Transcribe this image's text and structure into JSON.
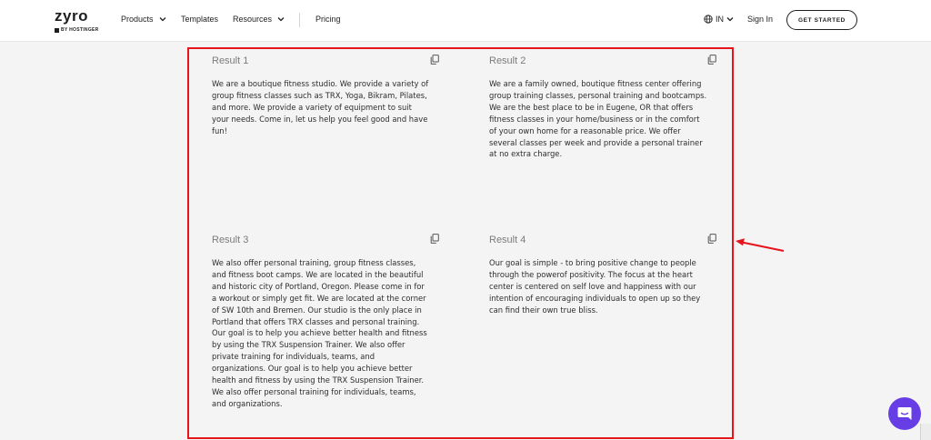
{
  "header": {
    "logo_word": "zyro",
    "logo_sub": "BY HOSTINGER",
    "nav": {
      "products": "Products",
      "templates": "Templates",
      "resources": "Resources",
      "pricing": "Pricing"
    },
    "language": "IN",
    "sign_in": "Sign In",
    "cta": "GET STARTED"
  },
  "results": [
    {
      "title": "Result 1",
      "body": "We are a boutique fitness studio. We provide a variety of group fitness classes such as TRX, Yoga, Bikram, Pilates, and more. We provide a variety of equipment to suit your needs. Come in, let us help you feel good and have fun!"
    },
    {
      "title": "Result 2",
      "body": "We are a family owned, boutique fitness center offering group training classes, personal training and bootcamps. We are the best place to be in Eugene, OR that offers fitness classes in your home/business or in the comfort of your own home for a reasonable price. We offer several classes per week and provide a personal trainer at no extra charge."
    },
    {
      "title": "Result 3",
      "body": "We also offer personal training, group fitness classes, and fitness boot camps. We are located in the beautiful and historic city of Portland, Oregon. Please come in for a workout or simply get fit. We are located at the corner of SW 10th and Bremen. Our studio is the only place in Portland that offers TRX classes and personal training. Our goal is to help you achieve better health and fitness by using the TRX Suspension Trainer. We also offer private training for individuals, teams, and organizations. Our goal is to help you achieve better health and fitness by using the TRX Suspension Trainer. We also offer personal training for individuals, teams, and organizations."
    },
    {
      "title": "Result 4",
      "body": "Our goal is simple - to bring positive change to people through the powerof positivity. The focus at the heart center is centered on self love and happiness with our intention of encouraging individuals to open up so they can find their own true bliss."
    }
  ],
  "icons": {
    "copy": "copy-icon",
    "globe": "globe-icon",
    "chevron": "chevron-down-icon",
    "chat": "chat-icon"
  },
  "colors": {
    "highlight": "#e8141b",
    "chat_bubble": "#673de6",
    "page_bg": "#f4f4f4"
  }
}
